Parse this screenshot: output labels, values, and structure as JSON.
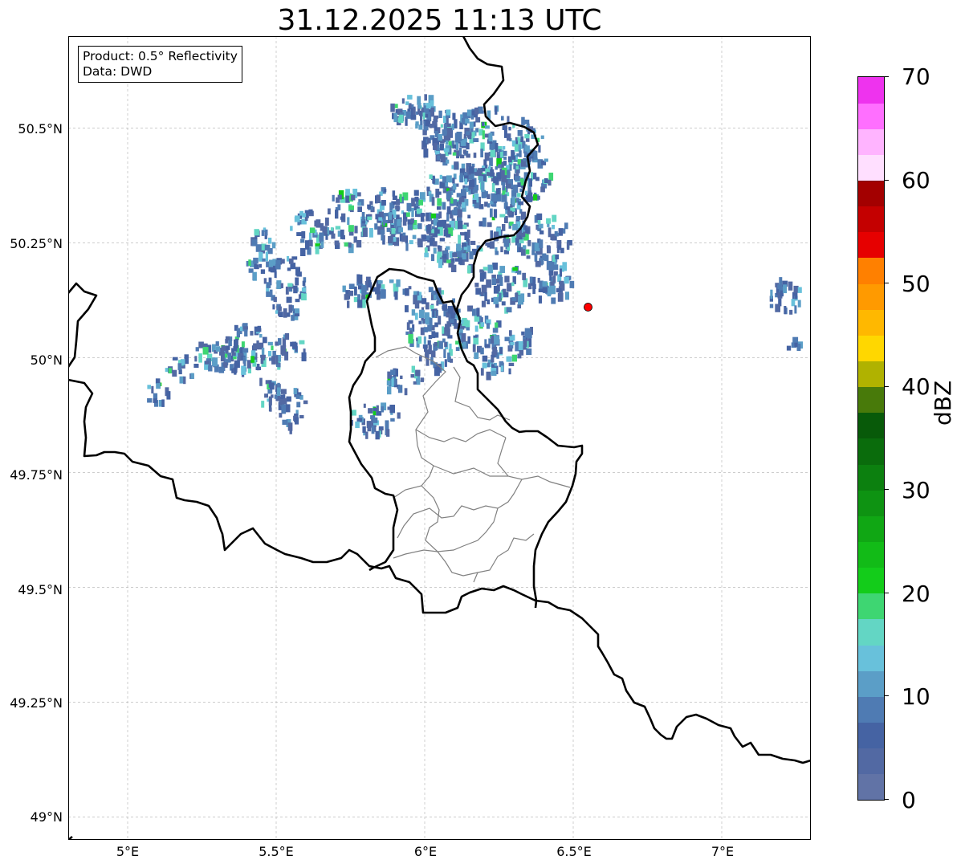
{
  "title": "31.12.2025 11:13 UTC",
  "info_box": {
    "product": "Product: 0.5° Reflectivity",
    "data": "Data: DWD"
  },
  "map": {
    "lon_range": [
      4.8,
      7.3
    ],
    "lat_range": [
      48.95,
      50.7
    ],
    "x_ticks": [
      "5°E",
      "5.5°E",
      "6°E",
      "6.5°E",
      "7°E"
    ],
    "y_ticks": [
      "50.5°N",
      "50.25°N",
      "50°N",
      "49.75°N",
      "49.5°N",
      "49.25°N",
      "49°N"
    ],
    "radar_site_marker": {
      "lon": 6.55,
      "lat": 50.11,
      "color": "#ff0000"
    },
    "gridlines": true
  },
  "colorbar": {
    "label": "dBZ",
    "min": 0,
    "max": 70,
    "tick_labels": [
      "0",
      "10",
      "20",
      "30",
      "40",
      "50",
      "60",
      "70"
    ],
    "colors": [
      "#6173a6",
      "#5269a3",
      "#4563a3",
      "#4f7bb3",
      "#5b9ec7",
      "#68c1db",
      "#63d6c4",
      "#3ed672",
      "#13cc1a",
      "#12bb17",
      "#10a714",
      "#0e9312",
      "#0c800f",
      "#0a6c0c",
      "#085a09",
      "#487a0a",
      "#b0b200",
      "#ffd700",
      "#ffb800",
      "#ff9a00",
      "#ff8000",
      "#e60000",
      "#c40000",
      "#a30000",
      "#7f0000",
      "#ffdfff",
      "#ffb4ff",
      "#ff6fff",
      "#ee33ee"
    ]
  }
}
